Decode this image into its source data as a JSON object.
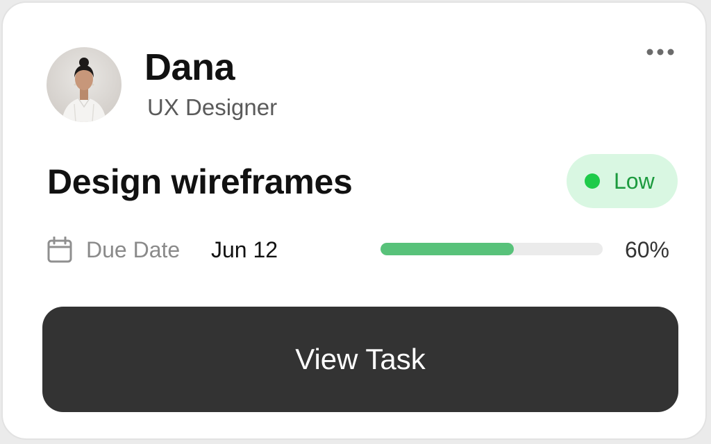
{
  "user": {
    "name": "Dana",
    "role": "UX Designer",
    "avatar_icon": "person-portrait-icon"
  },
  "menu": {
    "icon": "more-horizontal-icon"
  },
  "task": {
    "title": "Design wireframes",
    "priority": {
      "label": "Low",
      "dot_color": "#1fcb4a",
      "background": "#d9f7e2",
      "text_color": "#1c9a3e"
    },
    "due": {
      "icon": "calendar-icon",
      "label": "Due Date",
      "value": "Jun 12"
    },
    "progress": {
      "percent": 60,
      "label": "60%",
      "fill_color": "#58c27a"
    }
  },
  "actions": {
    "view_label": "View Task"
  }
}
